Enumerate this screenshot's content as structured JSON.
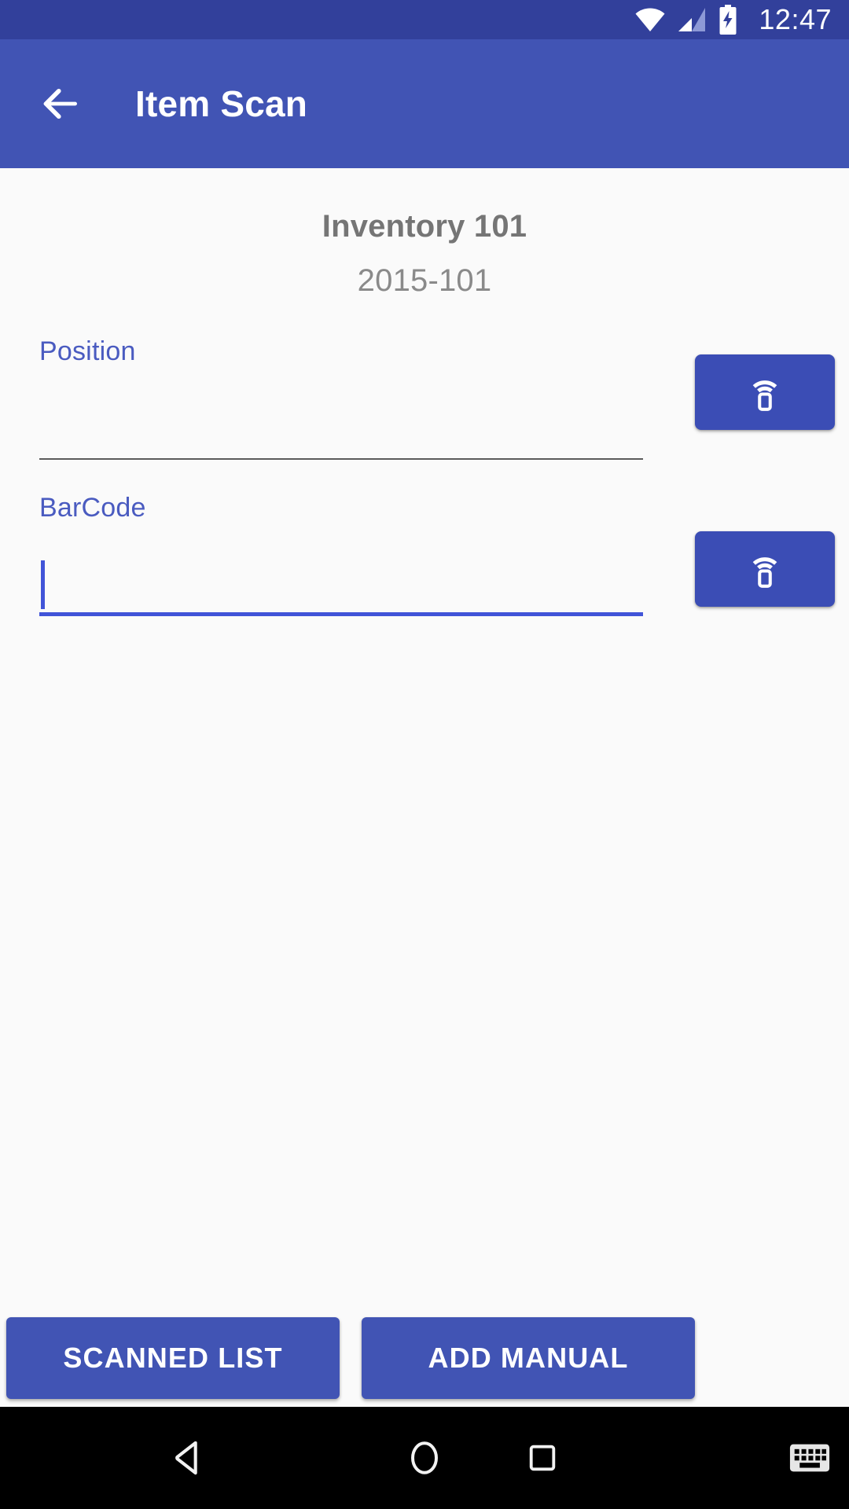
{
  "theme": {
    "status_bar_bg": "#32409b",
    "app_bar_bg": "#4154b4",
    "accent": "#4154d8",
    "button_bg": "#3b4db5",
    "page_bg": "#fafafa",
    "label_color": "#4a5bc0",
    "nav_bar_bg": "#000000"
  },
  "status_bar": {
    "time": "12:47",
    "icons": [
      "wifi-icon",
      "cellular-signal-icon",
      "battery-charging-icon"
    ]
  },
  "app_bar": {
    "back_icon": "arrow-back-icon",
    "title": "Item Scan"
  },
  "main": {
    "headline": "Inventory 101",
    "subhead": "2015-101",
    "fields": [
      {
        "label": "Position",
        "value": "",
        "placeholder": "",
        "focused": false,
        "scan_button_icon": "settings-remote-icon"
      },
      {
        "label": "BarCode",
        "value": "",
        "placeholder": "",
        "focused": true,
        "scan_button_icon": "settings-remote-icon"
      }
    ]
  },
  "bottom_actions": {
    "scanned_list_label": "SCANNED LIST",
    "add_manual_label": "ADD MANUAL"
  },
  "nav_bar": {
    "back": "nav-back-icon",
    "home": "nav-home-icon",
    "recents": "nav-recents-icon",
    "keyboard": "nav-keyboard-icon"
  }
}
